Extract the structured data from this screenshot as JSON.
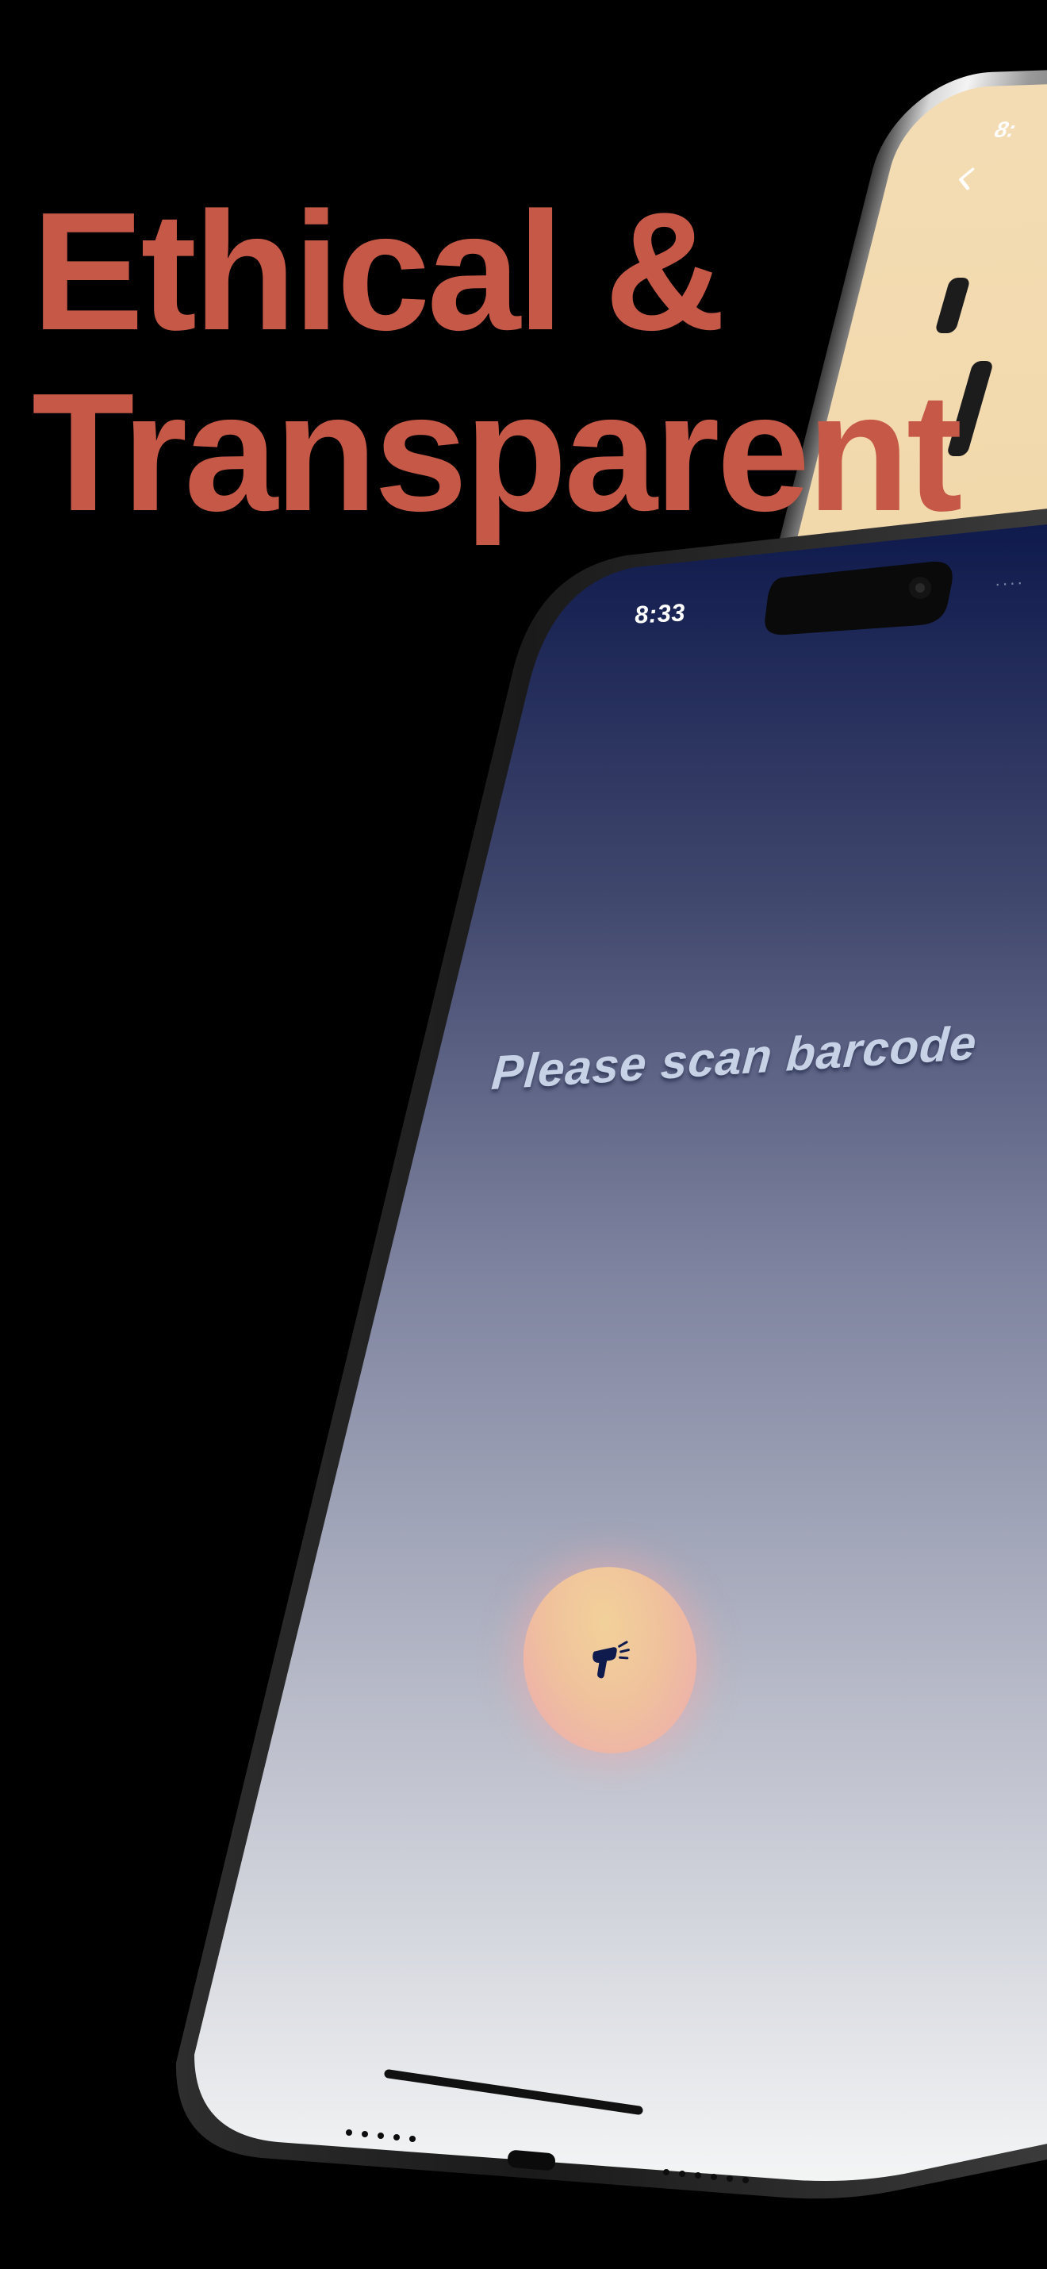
{
  "headline": {
    "line1": "Ethical &",
    "line2": "Transparent",
    "color": "#c65847"
  },
  "back_phone": {
    "status_time": "8:",
    "screen_color": "#f3dcb4",
    "icons": [
      "chevron-left-icon"
    ]
  },
  "main_phone": {
    "status_time": "8:33",
    "status_right": "····",
    "prompt": "Please scan barcode",
    "scan_button": {
      "icon": "barcode-scanner-icon",
      "gradient": [
        "#f2d19a",
        "#ebaab0"
      ],
      "icon_color": "#0f1a4d"
    },
    "screen_gradient": [
      "#0f1a4d",
      "#7e839f",
      "#f3f5f5"
    ]
  }
}
